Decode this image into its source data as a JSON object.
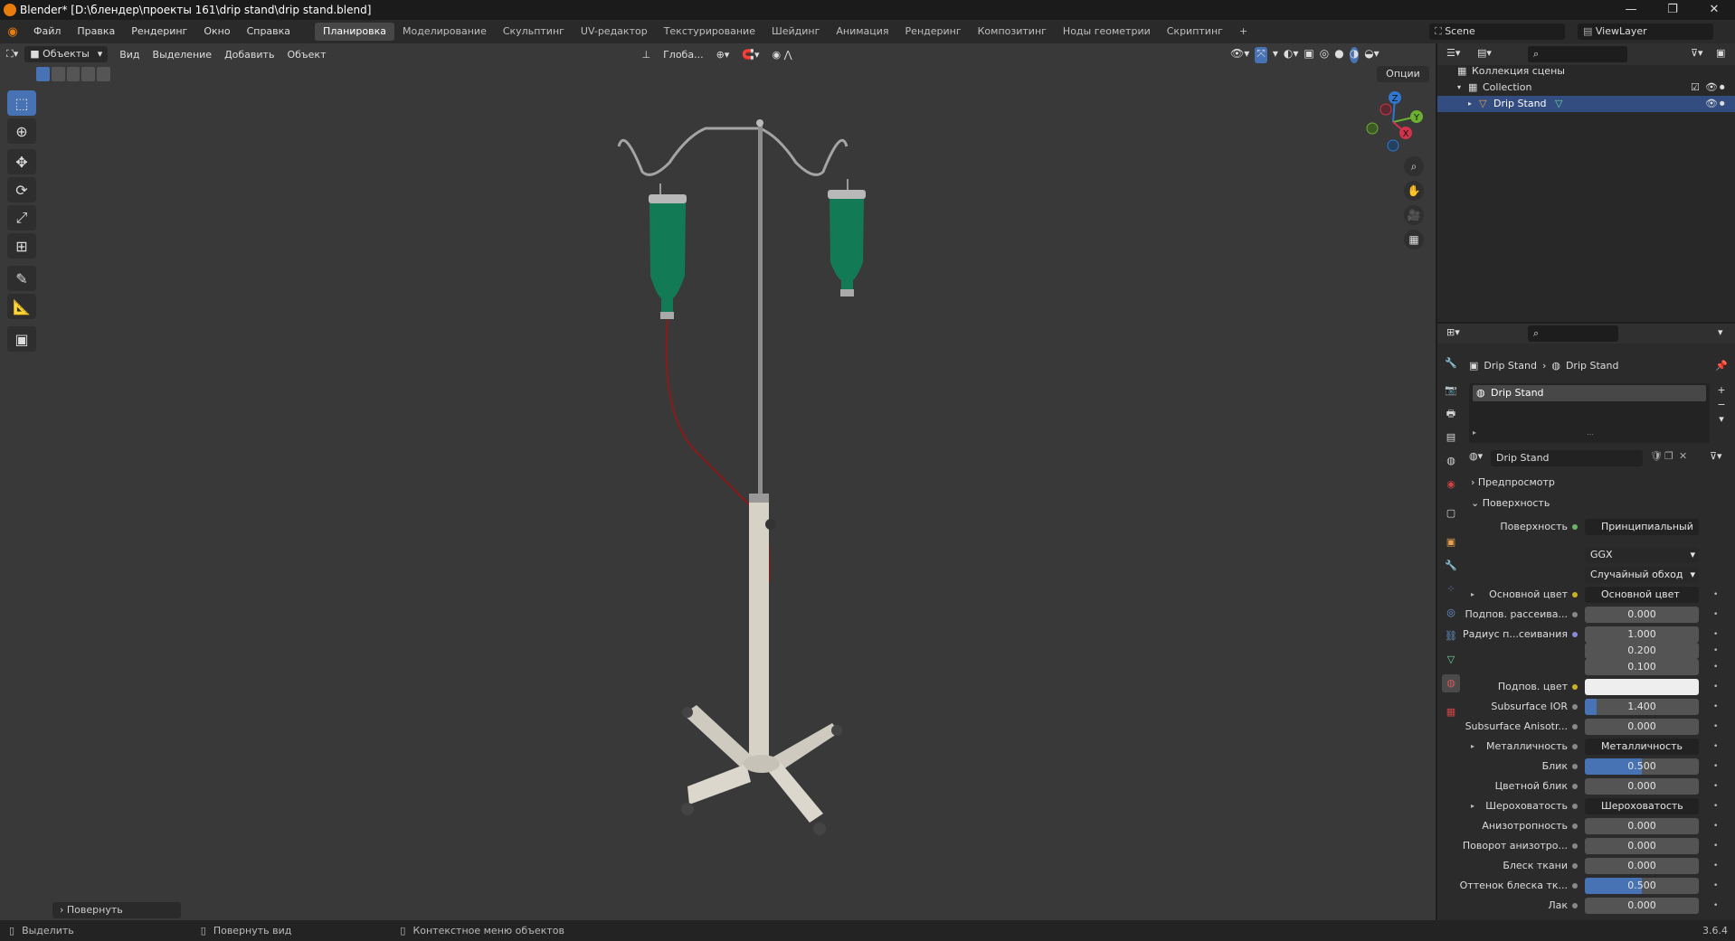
{
  "window": {
    "title": "Blender* [D:\\блендер\\проекты 161\\drip stand\\drip stand.blend]",
    "minimize": "—",
    "restore": "❐",
    "close": "✕"
  },
  "menu": [
    "Файл",
    "Правка",
    "Рендеринг",
    "Окно",
    "Справка"
  ],
  "workspaces": [
    "Планировка",
    "Моделирование",
    "Скульптинг",
    "UV-редактор",
    "Текстурирование",
    "Шейдинг",
    "Анимация",
    "Рендеринг",
    "Композитинг",
    "Ноды геометрии",
    "Скриптинг"
  ],
  "workspace_add": "+",
  "scene": {
    "name": "Scene",
    "view_layer": "ViewLayer"
  },
  "viewport_header": {
    "mode": "Объекты",
    "menus": [
      "Вид",
      "Выделение",
      "Добавить",
      "Объект"
    ],
    "orientation": "Глоба...",
    "options": "Опции"
  },
  "gizmo_axes": {
    "z": "Z",
    "y": "Y",
    "x": "X"
  },
  "last_operator": "Повернуть",
  "statusbar": {
    "select": "Выделить",
    "rotate_view": "Повернуть вид",
    "context_menu": "Контекстное меню объектов",
    "version": "3.6.4"
  },
  "outliner": {
    "root": "Коллекция сцены",
    "collection": "Collection",
    "object": "Drip Stand"
  },
  "properties": {
    "breadcrumb_object": "Drip Stand",
    "breadcrumb_material": "Drip Stand",
    "slot": "Drip Stand",
    "material_name": "Drip Stand",
    "panels": {
      "preview": "Предпросмотр",
      "surface": "Поверхность"
    },
    "surface_label": "Поверхность",
    "surface_value": "Принципиальный BSDF",
    "distribution": "GGX",
    "subsurface_method": "Случайный обход",
    "rows": [
      {
        "label": "Основной цвет",
        "value": "Основной цвет",
        "kind": "link",
        "arrow": true,
        "dot": "yel"
      },
      {
        "label": "Подпов. рассеива...",
        "value": "0.000",
        "kind": "num",
        "dot": "grey"
      },
      {
        "label": "Радиус п...сеивания",
        "value": "1.000",
        "kind": "num",
        "dot": "blue"
      },
      {
        "label": "",
        "value": "0.200",
        "kind": "num",
        "dot": "none"
      },
      {
        "label": "",
        "value": "0.100",
        "kind": "num",
        "dot": "none"
      },
      {
        "label": "Подпов. цвет",
        "value": "",
        "kind": "color",
        "dot": "yel"
      },
      {
        "label": "Subsurface IOR",
        "value": "1.400",
        "kind": "num",
        "fill": 0.1,
        "dot": "grey"
      },
      {
        "label": "Subsurface Anisotr...",
        "value": "0.000",
        "kind": "num",
        "dot": "grey"
      },
      {
        "label": "Металличность",
        "value": "Металличность",
        "kind": "link",
        "arrow": true,
        "dot": "grey"
      },
      {
        "label": "Блик",
        "value": "0.500",
        "kind": "num",
        "fill": 0.5,
        "dot": "grey"
      },
      {
        "label": "Цветной блик",
        "value": "0.000",
        "kind": "num",
        "dot": "grey"
      },
      {
        "label": "Шероховатость",
        "value": "Шероховатость",
        "kind": "link",
        "arrow": true,
        "dot": "grey"
      },
      {
        "label": "Анизотропность",
        "value": "0.000",
        "kind": "num",
        "dot": "grey"
      },
      {
        "label": "Поворот анизотро...",
        "value": "0.000",
        "kind": "num",
        "dot": "grey"
      },
      {
        "label": "Блеск ткани",
        "value": "0.000",
        "kind": "num",
        "dot": "grey"
      },
      {
        "label": "Оттенок блеска тк...",
        "value": "0.500",
        "kind": "num",
        "fill": 0.5,
        "dot": "grey"
      },
      {
        "label": "Лак",
        "value": "0.000",
        "kind": "num",
        "dot": "grey"
      }
    ]
  },
  "colors": {
    "accent": "#4772b3",
    "viewport_bg": "#393939",
    "liquid": "#137a56",
    "tube": "#8b1a1a"
  }
}
